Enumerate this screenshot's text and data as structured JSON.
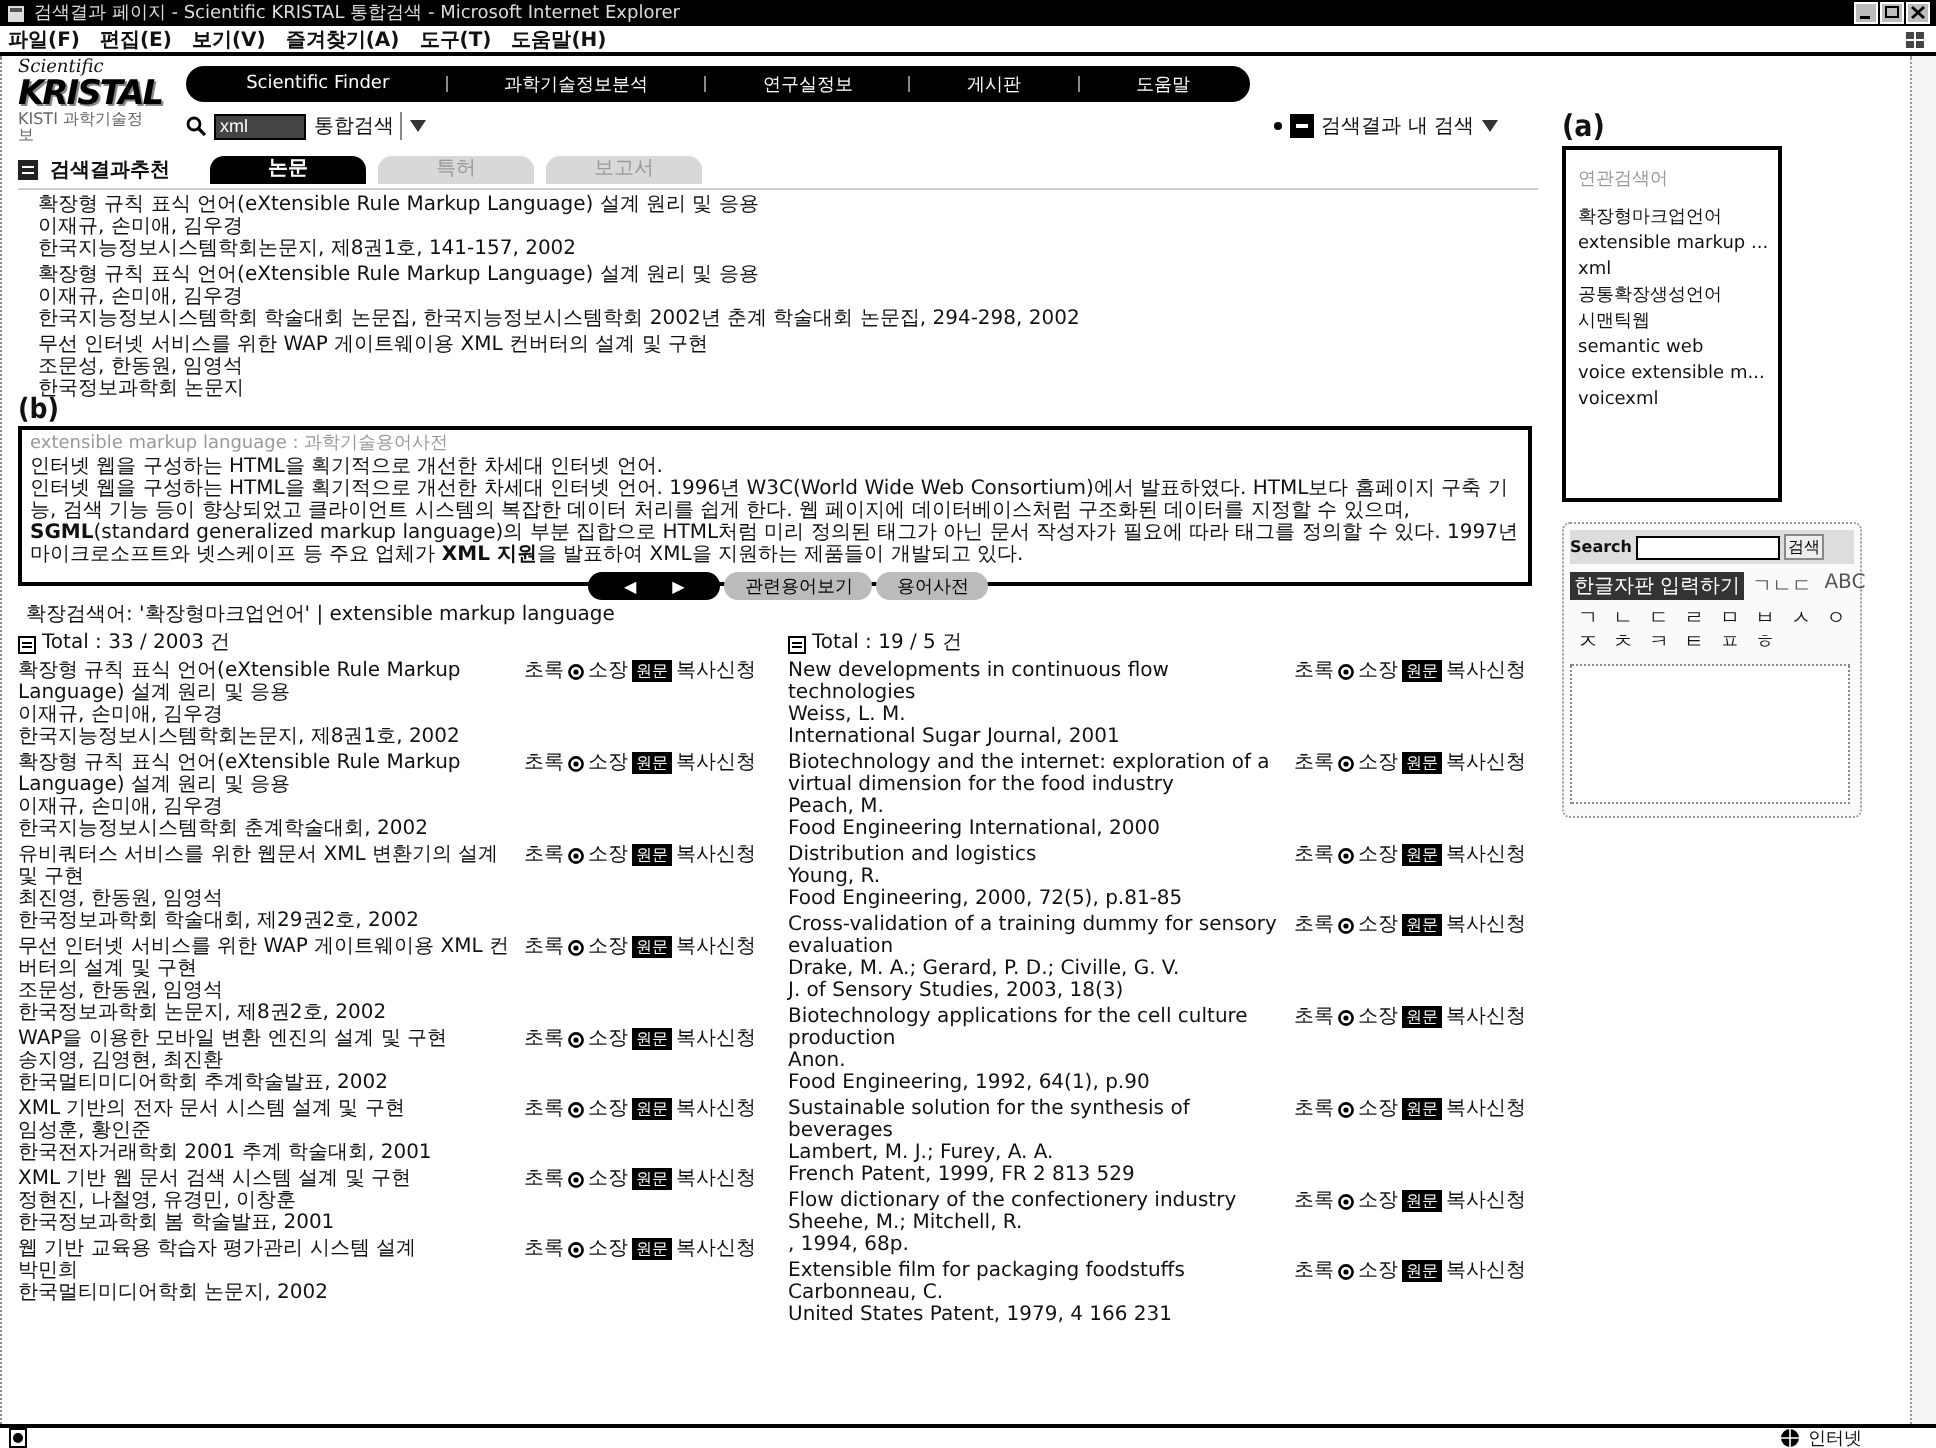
{
  "window": {
    "title": "검색결과 페이지 - Scientific KRISTAL 통합검색 - Microsoft Internet Explorer"
  },
  "menu": [
    "파일(F)",
    "편집(E)",
    "보기(V)",
    "즐겨찾기(A)",
    "도구(T)",
    "도움말(H)"
  ],
  "header": {
    "logo_script": "Scientific",
    "logo": "KRISTAL",
    "logo_sub": "KISTI 과학기술정보",
    "nav": [
      "Scientific Finder",
      "과학기술정보분석",
      "연구실정보",
      "게시판",
      "도움말"
    ],
    "search": {
      "query": "xml",
      "scope": "통합검색"
    },
    "inner_search": "검색결과 내 검색"
  },
  "recommend": {
    "heading": "검색결과추천",
    "tabs": [
      {
        "label": "논문",
        "selected": true
      },
      {
        "label": "특허",
        "selected": false
      },
      {
        "label": "보고서",
        "selected": false
      }
    ],
    "items": [
      {
        "title": "확장형 규칙 표식 언어(eXtensible Rule Markup Language) 설계 원리 및 응용",
        "authors": "이재규, 손미애, 김우경",
        "source": "한국지능정보시스템학회논문지, 제8권1호, 141-157, 2002"
      },
      {
        "title": "확장형 규칙 표식 언어(eXtensible Rule Markup Language) 설계 원리 및 응용",
        "authors": "이재규, 손미애, 김우경",
        "source": "한국지능정보시스템학회 학술대회 논문집, 한국지능정보시스템학회 2002년 춘계 학술대회 논문집, 294-298, 2002"
      },
      {
        "title": "무선 인터넷 서비스를 위한 WAP 게이트웨이용 XML 컨버터의 설계 및 구현",
        "authors": "조문성, 한동원, 임영석",
        "source": "한국정보과학회 논문지"
      }
    ]
  },
  "definition": {
    "marker": "(b)",
    "source": "extensible markup language : 과학기술용어사전",
    "lead": "인터넷 웹을 구성하는 HTML을 획기적으로 개선한 차세대 인터넷 언어.",
    "body": "인터넷 웹을 구성하는 HTML을 획기적으로 개선한 차세대 인터넷 언어. 1996년 W3C(World Wide Web Consortium)에서 발표하였다. HTML보다 홈페이지 구축 기능, 검색 기능 등이 향상되었고 클라이언트 시스템의 복잡한 데이터 처리를 쉽게 한다. 웹 페이지에 데이터베이스처럼 구조화된 데이터를 지정할 수 있으며, **SGML**(standard generalized markup language)의 부분 집합으로 HTML처럼 미리 정의된 태그가 아닌 문서 작성자가 필요에 따라 태그를 정의할 수 있다. 1997년 마이크로소프트와 넷스케이프 등 주요 업체가 **XML 지원**을 발표하여 XML을 지원하는 제품들이 개발되고 있다.",
    "nav": [
      "◀",
      "▶"
    ],
    "buttons": [
      "관련용어보기",
      "용어사전"
    ]
  },
  "expansion": "확장검색어: '확장형마크업언어' | extensible markup language",
  "results": [
    {
      "total": "Total : 33 / 2003 건",
      "items": [
        {
          "title": "확장형 규칙 표식 언어(eXtensible Rule Markup Language) 설계 원리 및 응용",
          "authors": "이재규, 손미애, 김우경",
          "source": "한국지능정보시스템학회논문지, 제8권1호, 2002",
          "actions": [
            "초록",
            "소장",
            "원문",
            "복사신청"
          ]
        },
        {
          "title": "확장형 규칙 표식 언어(eXtensible Rule Markup Language) 설계 원리 및 응용",
          "authors": "이재규, 손미애, 김우경",
          "source": "한국지능정보시스템학회 춘계학술대회, 2002",
          "actions": [
            "초록",
            "소장",
            "원문",
            "복사신청"
          ]
        },
        {
          "title": "유비쿼터스 서비스를 위한 웹문서 XML 변환기의 설계 및 구현",
          "authors": "최진영, 한동원, 임영석",
          "source": "한국정보과학회 학술대회, 제29권2호, 2002",
          "actions": [
            "초록",
            "소장",
            "원문",
            "복사신청"
          ]
        },
        {
          "title": "무선 인터넷 서비스를 위한 WAP 게이트웨이용 XML 컨버터의 설계 및 구현",
          "authors": "조문성, 한동원, 임영석",
          "source": "한국정보과학회 논문지, 제8권2호, 2002",
          "actions": [
            "초록",
            "소장",
            "원문",
            "복사신청"
          ]
        },
        {
          "title": "WAP을 이용한 모바일 변환 엔진의 설계 및 구현",
          "authors": "송지영, 김영현, 최진환",
          "source": "한국멀티미디어학회 추계학술발표, 2002",
          "actions": [
            "초록",
            "소장",
            "원문",
            "복사신청"
          ]
        },
        {
          "title": "XML 기반의 전자 문서 시스템 설계 및 구현",
          "authors": "임성훈, 황인준",
          "source": "한국전자거래학회 2001 추계 학술대회, 2001",
          "actions": [
            "초록",
            "소장",
            "원문",
            "복사신청"
          ]
        },
        {
          "title": "XML 기반 웹 문서 검색 시스템 설계 및 구현",
          "authors": "정현진, 나철영, 유경민, 이창훈",
          "source": "한국정보과학회 봄 학술발표, 2001",
          "actions": [
            "초록",
            "소장",
            "원문",
            "복사신청"
          ]
        },
        {
          "title": "웹 기반 교육용 학습자 평가관리 시스템 설계",
          "authors": "박민희",
          "source": "한국멀티미디어학회 논문지, 2002",
          "actions": [
            "초록",
            "소장",
            "원문",
            "복사신청"
          ]
        }
      ]
    },
    {
      "total": "Total : 19 / 5 건",
      "items": [
        {
          "title": "New developments in continuous flow technologies",
          "authors": "Weiss, L. M.",
          "source": "International Sugar Journal, 2001",
          "actions": [
            "초록",
            "소장",
            "원문",
            "복사신청"
          ]
        },
        {
          "title": "Biotechnology and the internet: exploration of a virtual dimension for the food industry",
          "authors": "Peach, M.",
          "source": "Food Engineering International, 2000",
          "actions": [
            "초록",
            "소장",
            "원문",
            "복사신청"
          ]
        },
        {
          "title": "Distribution and logistics",
          "authors": "Young, R.",
          "source": "Food Engineering, 2000, 72(5), p.81-85",
          "actions": [
            "초록",
            "소장",
            "원문",
            "복사신청"
          ]
        },
        {
          "title": "Cross-validation of a training dummy for sensory evaluation",
          "authors": "Drake, M. A.; Gerard, P. D.; Civille, G. V.",
          "source": "J. of Sensory Studies, 2003, 18(3)",
          "actions": [
            "초록",
            "소장",
            "원문",
            "복사신청"
          ]
        },
        {
          "title": "Biotechnology applications for the cell culture production",
          "authors": "Anon.",
          "source": "Food Engineering, 1992, 64(1), p.90",
          "actions": [
            "초록",
            "소장",
            "원문",
            "복사신청"
          ]
        },
        {
          "title": "Sustainable solution for the synthesis of beverages",
          "authors": "Lambert, M. J.; Furey, A. A.",
          "source": "French Patent, 1999, FR 2 813 529",
          "actions": [
            "초록",
            "소장",
            "원문",
            "복사신청"
          ]
        },
        {
          "title": "Flow dictionary of the confectionery industry",
          "authors": "Sheehe, M.; Mitchell, R.",
          "source": ", 1994, 68p.",
          "actions": [
            "초록",
            "소장",
            "원문",
            "복사신청"
          ]
        },
        {
          "title": "Extensible film for packaging foodstuffs",
          "authors": "Carbonneau, C.",
          "source": "United States Patent, 1979, 4 166 231",
          "actions": [
            "초록",
            "소장",
            "원문",
            "복사신청"
          ]
        }
      ]
    }
  ],
  "related": {
    "marker": "(a)",
    "heading": "연관검색어",
    "items": [
      "확장형마크업언어",
      "extensible markup ...",
      "xml",
      "공통확장생성언어",
      "시맨틱웹",
      "semantic web",
      "voice extensible m...",
      "voicexml"
    ]
  },
  "keyboard": {
    "label": "Search",
    "button": "검색",
    "tabs": [
      {
        "label": "한글자판 입력하기",
        "selected": true
      },
      {
        "label": "ㄱㄴㄷ",
        "selected": false
      },
      {
        "label": "ABC",
        "selected": false
      }
    ],
    "keys": [
      "ㄱ",
      "ㄴ",
      "ㄷ",
      "ㄹ",
      "ㅁ",
      "ㅂ",
      "ㅅ",
      "ㅇ",
      "ㅈ",
      "ㅊ",
      "ㅋ",
      "ㅌ",
      "ㅍ",
      "ㅎ"
    ]
  },
  "status_bar": {
    "zone": "인터넷"
  }
}
